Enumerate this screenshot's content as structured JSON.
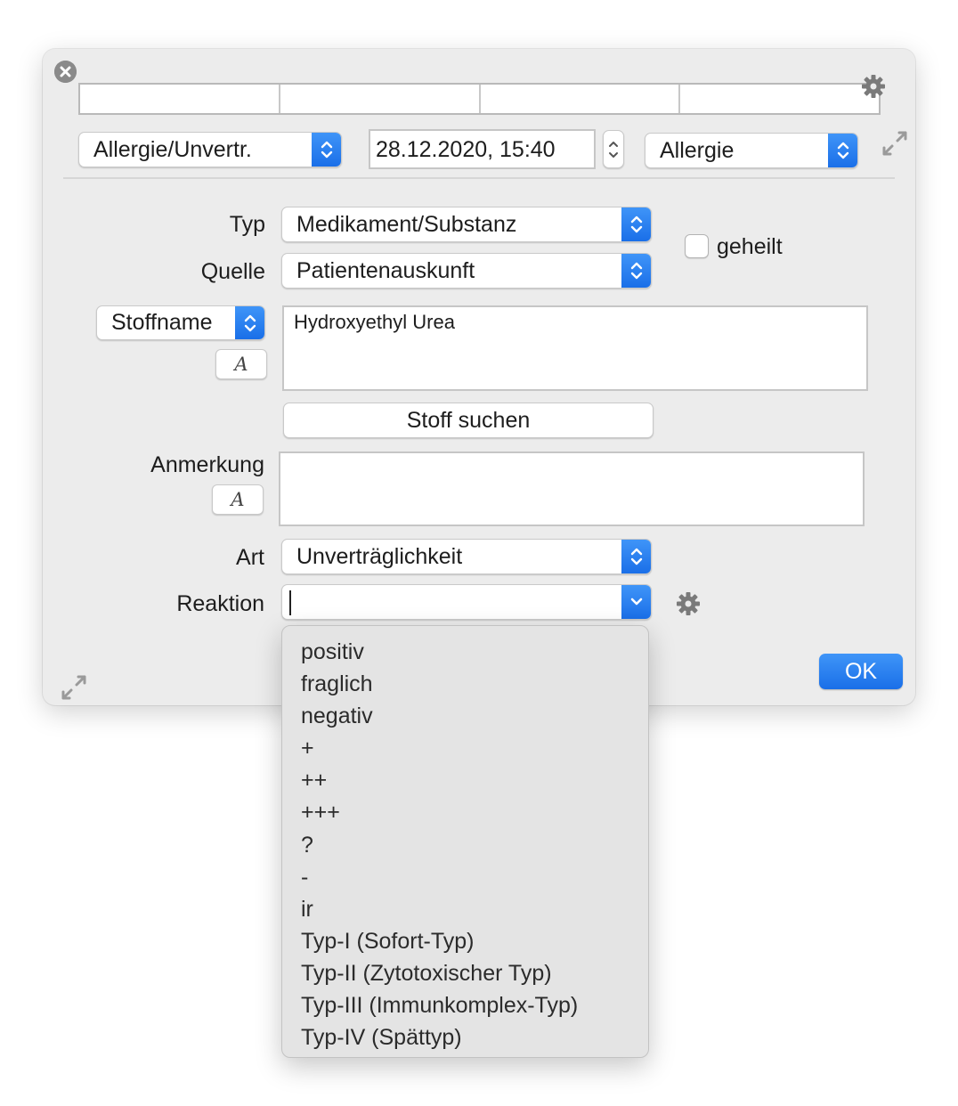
{
  "header": {
    "category_popup": "Allergie/Unvertr.",
    "datetime": "28.12.2020, 15:40",
    "type_popup": "Allergie"
  },
  "form": {
    "typ_label": "Typ",
    "typ_value": "Medikament/Substanz",
    "quelle_label": "Quelle",
    "quelle_value": "Patientenauskunft",
    "geheilt_label": "geheilt",
    "geheilt_checked": false,
    "stoffname_popup": "Stoffname",
    "stoffname_value": "Hydroxyethyl Urea",
    "format_button_glyph": "A",
    "stoff_suchen_button": "Stoff suchen",
    "anmerkung_label": "Anmerkung",
    "anmerkung_value": "",
    "art_label": "Art",
    "art_value": "Unverträglichkeit",
    "reaktion_label": "Reaktion",
    "reaktion_value": ""
  },
  "ok_button": "OK",
  "reaktion_menu": [
    "positiv",
    "fraglich",
    "negativ",
    "+",
    "++",
    "+++",
    "?",
    "-",
    "ir",
    "Typ-I (Sofort-Typ)",
    "Typ-II (Zytotoxischer Typ)",
    "Typ-III (Immunkomplex-Typ)",
    "Typ-IV (Spättyp)"
  ],
  "colors": {
    "accent": "#1a6fe8",
    "window_bg": "#ececec",
    "menu_bg": "#e4e4e4"
  },
  "icons": [
    "close-icon",
    "gear-icon",
    "chevron-updown-icon",
    "chevron-down-icon",
    "stepper-icon",
    "resize-icon"
  ]
}
